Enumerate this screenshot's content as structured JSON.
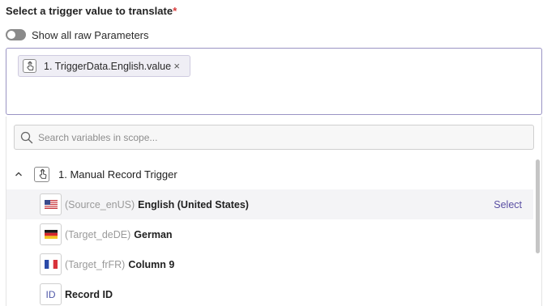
{
  "field": {
    "label": "Select a trigger value to translate",
    "required_mark": "*"
  },
  "toggle": {
    "label": "Show all raw Parameters",
    "on": false
  },
  "selected_chip": {
    "text": "1. TriggerData.English.value",
    "icon": "trigger-hand-icon",
    "remove": "×"
  },
  "search": {
    "placeholder": "Search variables in scope..."
  },
  "group": {
    "label": "1. Manual Record Trigger",
    "icon": "trigger-hand-icon",
    "expanded": true
  },
  "variables": [
    {
      "id": "(Source_enUS)",
      "name": "English (United States)",
      "icon": "us-flag-icon",
      "action": "Select"
    },
    {
      "id": "(Target_deDE)",
      "name": "German",
      "icon": "de-flag-icon"
    },
    {
      "id": "(Target_frFR)",
      "name": "Column 9",
      "icon": "fr-flag-icon"
    },
    {
      "id": "",
      "name": "Record ID",
      "icon": "id-icon",
      "icon_text": "ID"
    }
  ],
  "colors": {
    "accent": "#5a4fa3",
    "required": "#d93b3b",
    "border": "#9a94c4"
  }
}
